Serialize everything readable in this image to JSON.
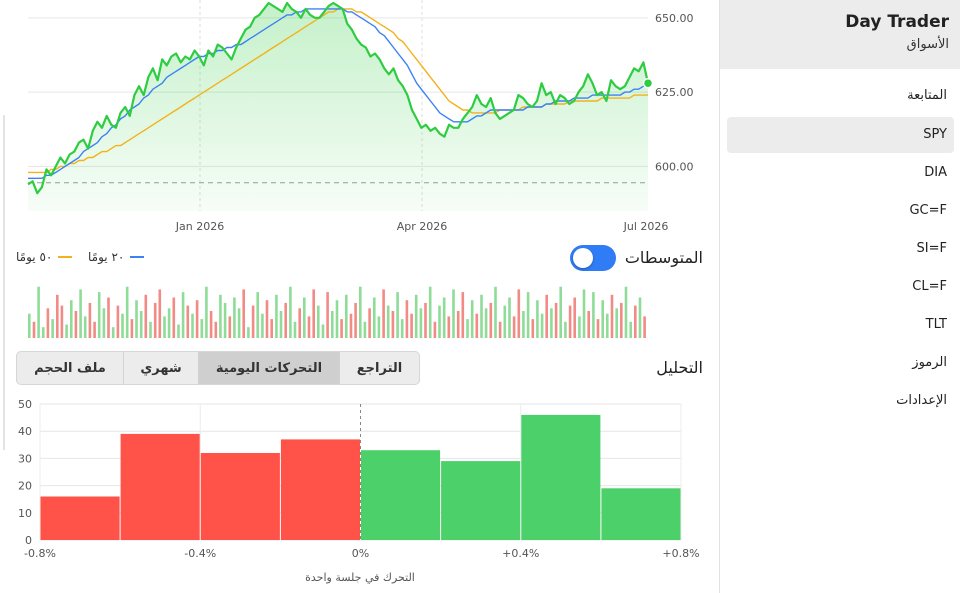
{
  "sidebar": {
    "title": "Day Trader",
    "subtitle": "الأسواق",
    "items": [
      {
        "label": "المتابعة",
        "selected": false
      },
      {
        "label": "SPY",
        "selected": true
      },
      {
        "label": "DIA",
        "selected": false
      },
      {
        "label": "GC=F",
        "selected": false
      },
      {
        "label": "SI=F",
        "selected": false
      },
      {
        "label": "CL=F",
        "selected": false
      },
      {
        "label": "TLT",
        "selected": false
      },
      {
        "label": "الرموز",
        "selected": false
      },
      {
        "label": "الإعدادات",
        "selected": false
      }
    ]
  },
  "averages": {
    "toggle_label": "المتوسطات",
    "toggle_on": true,
    "legend_20": "٢٠ يومًا",
    "legend_50": "٥٠ يومًا"
  },
  "analysis": {
    "label": "التحليل",
    "tabs": [
      "التراجع",
      "التحركات اليومية",
      "شهري",
      "ملف الحجم"
    ],
    "selected_tab": 1
  },
  "colors": {
    "price": "#2ecc40",
    "ma20": "#3b82f6",
    "ma50": "#f2b21b",
    "up": "#4cd06a",
    "down": "#ff5349"
  },
  "chart_data": [
    {
      "type": "line",
      "x_ticks": [
        "Jan 2026",
        "Apr 2026",
        "Jul 2026"
      ],
      "y_ticks": [
        600,
        625,
        650
      ],
      "y_tick_labels": [
        "600.00",
        "625.00",
        "650.00"
      ],
      "ylim": [
        585,
        656
      ],
      "reference_line": 594.5,
      "grid": true,
      "series": [
        {
          "name": "",
          "values": [
            594,
            595,
            591,
            593,
            599,
            597,
            600,
            603,
            601,
            604,
            605,
            608,
            609,
            606,
            612,
            615,
            613,
            617,
            614,
            613,
            618,
            620,
            617,
            624,
            627,
            624,
            630,
            633,
            629,
            636,
            634,
            637,
            638,
            635,
            637,
            636,
            639,
            637,
            634,
            639,
            637,
            641,
            640,
            638,
            636,
            640,
            643,
            646,
            647,
            650,
            651,
            653,
            655,
            654,
            653,
            652,
            655,
            653,
            652,
            650,
            653,
            651,
            650,
            650,
            652,
            654,
            655,
            654,
            653,
            648,
            646,
            643,
            641,
            640,
            637,
            638,
            636,
            633,
            631,
            633,
            629,
            627,
            624,
            619,
            616,
            613,
            614,
            612,
            613,
            611,
            610,
            614,
            613,
            613,
            616,
            618,
            620,
            624,
            621,
            620,
            623,
            618,
            616,
            617,
            618,
            619,
            624,
            623,
            621,
            620,
            622,
            628,
            624,
            625,
            621,
            624,
            623,
            621,
            622,
            625,
            627,
            631,
            628,
            624,
            625,
            622,
            629,
            627,
            626,
            627,
            630,
            633,
            632,
            635,
            628
          ]
        },
        {
          "name": "٢٠ يومًا",
          "values": [
            596,
            596,
            596,
            596,
            597,
            597,
            598,
            599,
            600,
            601,
            602,
            603,
            605,
            606,
            607,
            608,
            610,
            611,
            613,
            614,
            616,
            617,
            619,
            620,
            621,
            623,
            624,
            626,
            627,
            628,
            630,
            631,
            632,
            633,
            634,
            635,
            636,
            637,
            637,
            638,
            638,
            639,
            639,
            640,
            640,
            641,
            641,
            642,
            643,
            644,
            645,
            646,
            647,
            648,
            649,
            650,
            651,
            651,
            652,
            652,
            653,
            653,
            653,
            653,
            653,
            653,
            653,
            653,
            653,
            652,
            652,
            651,
            650,
            649,
            648,
            647,
            645,
            644,
            642,
            640,
            638,
            636,
            634,
            631,
            628,
            626,
            624,
            622,
            620,
            618,
            617,
            616,
            615,
            615,
            615,
            615,
            616,
            617,
            617,
            618,
            619,
            619,
            619,
            619,
            619,
            619,
            619,
            619,
            620,
            620,
            620,
            620,
            621,
            621,
            622,
            622,
            622,
            622,
            623,
            623,
            623,
            623,
            624,
            624,
            624,
            624,
            624,
            624,
            624,
            625,
            625,
            626,
            626,
            627,
            627
          ]
        },
        {
          "name": "٥٠ يومًا",
          "values": [
            598,
            598,
            598,
            598,
            598,
            599,
            599,
            600,
            600,
            601,
            601,
            602,
            602,
            603,
            603,
            604,
            605,
            605,
            606,
            607,
            607,
            608,
            609,
            610,
            611,
            612,
            613,
            614,
            615,
            616,
            617,
            618,
            619,
            620,
            621,
            622,
            623,
            624,
            625,
            626,
            627,
            628,
            629,
            630,
            631,
            632,
            633,
            634,
            635,
            636,
            637,
            638,
            639,
            640,
            641,
            642,
            643,
            644,
            645,
            646,
            647,
            648,
            649,
            650,
            651,
            652,
            652,
            653,
            653,
            653,
            653,
            652,
            652,
            651,
            650,
            649,
            648,
            647,
            646,
            645,
            643,
            642,
            640,
            638,
            636,
            634,
            632,
            630,
            628,
            626,
            624,
            622,
            621,
            620,
            619,
            619,
            618,
            618,
            618,
            618,
            618,
            618,
            619,
            619,
            619,
            619,
            619,
            620,
            620,
            620,
            620,
            620,
            621,
            621,
            621,
            621,
            621,
            622,
            622,
            622,
            622,
            622,
            622,
            622,
            623,
            623,
            623,
            623,
            623,
            623,
            623,
            624,
            624,
            624,
            624
          ]
        }
      ]
    },
    {
      "type": "bar",
      "title": "",
      "note": "daily volume bars, green = up day, red = down day",
      "values": [
        0.45,
        0.3,
        0.95,
        0.2,
        0.55,
        0.35,
        0.8,
        0.6,
        0.25,
        0.7,
        0.5,
        0.9,
        0.4,
        0.65,
        0.3,
        0.85,
        0.55,
        0.75,
        0.2,
        0.6,
        0.45,
        0.95,
        0.35,
        0.7,
        0.5,
        0.8,
        0.3,
        0.65,
        0.9,
        0.4,
        0.55,
        0.75,
        0.25,
        0.85,
        0.6,
        0.45,
        0.7,
        0.35,
        0.95,
        0.5,
        0.3,
        0.8,
        0.65,
        0.4,
        0.75,
        0.55,
        0.9,
        0.2,
        0.6,
        0.85,
        0.45,
        0.7,
        0.35,
        0.8,
        0.5,
        0.65,
        0.95,
        0.3,
        0.55,
        0.75,
        0.4,
        0.9,
        0.6,
        0.25,
        0.85,
        0.5,
        0.7,
        0.35,
        0.8,
        0.45,
        0.65,
        0.95,
        0.3,
        0.55,
        0.75,
        0.4,
        0.9,
        0.6,
        0.5,
        0.85,
        0.35,
        0.7,
        0.45,
        0.8,
        0.55,
        0.65,
        0.95,
        0.3,
        0.6,
        0.75,
        0.4,
        0.9,
        0.5,
        0.85,
        0.35,
        0.7,
        0.45,
        0.8,
        0.55,
        0.65,
        0.95,
        0.3,
        0.6,
        0.75,
        0.4,
        0.9,
        0.5,
        0.85,
        0.35,
        0.7,
        0.45,
        0.8,
        0.55,
        0.65,
        0.95,
        0.3,
        0.6,
        0.75,
        0.4,
        0.9,
        0.5,
        0.85,
        0.35,
        0.7,
        0.45,
        0.8,
        0.55,
        0.65,
        0.95,
        0.3,
        0.6,
        0.75,
        0.4
      ],
      "up": [
        1,
        0,
        1,
        1,
        0,
        1,
        0,
        0,
        1,
        1,
        0,
        1,
        1,
        0,
        0,
        1,
        1,
        0,
        1,
        0,
        1,
        1,
        0,
        1,
        1,
        0,
        1,
        0,
        0,
        1,
        1,
        0,
        1,
        1,
        0,
        1,
        0,
        1,
        1,
        0,
        0,
        1,
        1,
        0,
        1,
        1,
        0,
        1,
        0,
        1,
        1,
        0,
        0,
        1,
        1,
        0,
        1,
        1,
        0,
        1,
        0,
        0,
        1,
        1,
        0,
        1,
        1,
        0,
        1,
        0,
        0,
        1,
        1,
        0,
        1,
        1,
        0,
        1,
        0,
        1,
        1,
        0,
        0,
        1,
        1,
        0,
        1,
        0,
        1,
        1,
        0,
        1,
        0,
        0,
        1,
        1,
        0,
        1,
        1,
        0,
        1,
        0,
        1,
        1,
        0,
        0,
        1,
        1,
        0,
        1,
        1,
        0,
        1,
        0,
        1,
        1,
        0,
        0,
        1,
        1,
        0,
        1,
        0,
        1,
        1,
        0,
        1,
        0,
        1,
        1,
        0,
        1,
        0,
        1,
        1
      ]
    },
    {
      "type": "bar",
      "xlabel": "التحرك في جلسة واحدة",
      "ylim": [
        0,
        50
      ],
      "y_ticks": [
        0,
        10,
        20,
        30,
        40,
        50
      ],
      "x_tick_labels": [
        "-0.8%",
        "-0.4%",
        "0%",
        "+0.4%",
        "+0.8%"
      ],
      "bins": [
        {
          "range": [
            -0.8,
            -0.6
          ],
          "value": 16
        },
        {
          "range": [
            -0.6,
            -0.4
          ],
          "value": 39
        },
        {
          "range": [
            -0.4,
            -0.2
          ],
          "value": 32
        },
        {
          "range": [
            -0.2,
            0.0
          ],
          "value": 37
        },
        {
          "range": [
            0.0,
            0.2
          ],
          "value": 33
        },
        {
          "range": [
            0.2,
            0.4
          ],
          "value": 29
        },
        {
          "range": [
            0.4,
            0.6
          ],
          "value": 46
        },
        {
          "range": [
            0.6,
            0.8
          ],
          "value": 19
        }
      ]
    }
  ]
}
